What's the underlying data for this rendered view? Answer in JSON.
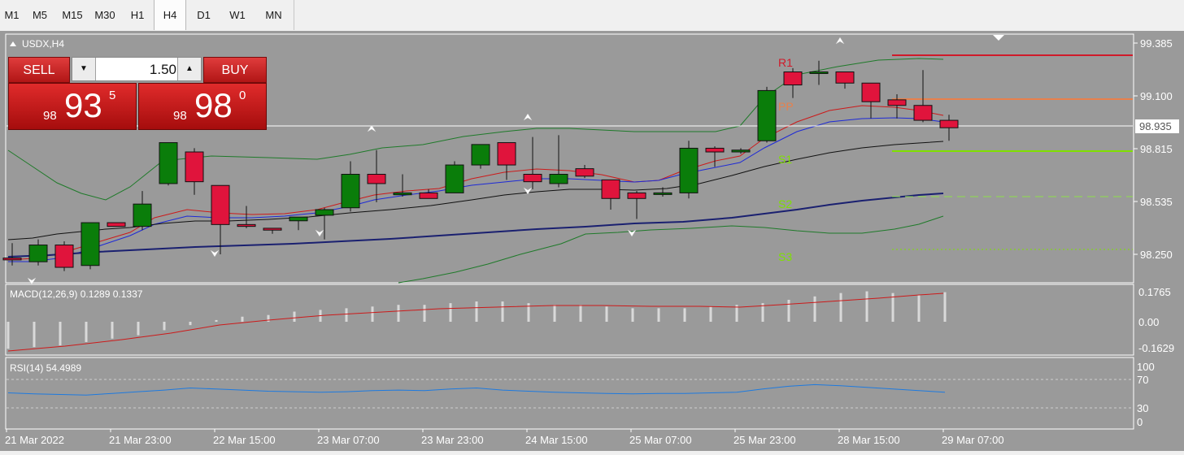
{
  "timeframes": [
    "M1",
    "M5",
    "M15",
    "M30",
    "H1",
    "H4",
    "D1",
    "W1",
    "MN"
  ],
  "active_timeframe": "H4",
  "chart": {
    "symbol_title": "USDX,H4",
    "price_axis": [
      "99.385",
      "99.100",
      "98.815",
      "98.535",
      "98.250"
    ],
    "current_price": "98.935",
    "pivot_labels": {
      "r1": "R1",
      "pp": "PP",
      "s1": "S1",
      "s2": "S2",
      "s3": "S3"
    },
    "date_labels": [
      "21 Mar 2022",
      "21 Mar 23:00",
      "22 Mar 15:00",
      "23 Mar 07:00",
      "23 Mar 23:00",
      "24 Mar 15:00",
      "25 Mar 07:00",
      "25 Mar 23:00",
      "28 Mar 15:00",
      "29 Mar 07:00"
    ]
  },
  "macd": {
    "label": "MACD(12,26,9) 0.1289 0.1337",
    "axis": [
      "0.1765",
      "0.00",
      "-0.1629"
    ]
  },
  "rsi": {
    "label": "RSI(14) 54.4989",
    "axis": [
      "100",
      "70",
      "30",
      "0"
    ]
  },
  "trade": {
    "sell_label": "SELL",
    "buy_label": "BUY",
    "volume": "1.50",
    "sell_price": {
      "small": "98",
      "big": "93",
      "sup": "5"
    },
    "buy_price": {
      "small": "98",
      "big": "98",
      "sup": "0"
    }
  },
  "colors": {
    "bull": "#0a7d0a",
    "bear": "#e0143c",
    "background": "#9a9a9a",
    "sell_button": "#c81e1e"
  },
  "chart_data": {
    "type": "candlestick",
    "candles": [
      {
        "o": 98.23,
        "h": 98.31,
        "l": 98.19,
        "c": 98.22
      },
      {
        "o": 98.21,
        "h": 98.33,
        "l": 98.19,
        "c": 98.3
      },
      {
        "o": 98.3,
        "h": 98.32,
        "l": 98.16,
        "c": 98.18
      },
      {
        "o": 98.19,
        "h": 98.42,
        "l": 98.17,
        "c": 98.42
      },
      {
        "o": 98.42,
        "h": 98.42,
        "l": 98.4,
        "c": 98.4
      },
      {
        "o": 98.4,
        "h": 98.59,
        "l": 98.38,
        "c": 98.52
      },
      {
        "o": 98.63,
        "h": 98.82,
        "l": 98.62,
        "c": 98.85
      },
      {
        "o": 98.8,
        "h": 98.82,
        "l": 98.57,
        "c": 98.64
      },
      {
        "o": 98.62,
        "h": 98.62,
        "l": 98.25,
        "c": 98.41
      },
      {
        "o": 98.41,
        "h": 98.51,
        "l": 98.39,
        "c": 98.4
      },
      {
        "o": 98.39,
        "h": 98.39,
        "l": 98.36,
        "c": 98.38
      },
      {
        "o": 98.43,
        "h": 98.45,
        "l": 98.38,
        "c": 98.45
      },
      {
        "o": 98.46,
        "h": 98.5,
        "l": 98.33,
        "c": 98.49
      },
      {
        "o": 98.5,
        "h": 98.75,
        "l": 98.48,
        "c": 98.68
      },
      {
        "o": 98.68,
        "h": 98.81,
        "l": 98.53,
        "c": 98.63
      },
      {
        "o": 98.57,
        "h": 98.68,
        "l": 98.56,
        "c": 98.58
      },
      {
        "o": 98.58,
        "h": 98.6,
        "l": 98.55,
        "c": 98.55
      },
      {
        "o": 98.58,
        "h": 98.75,
        "l": 98.58,
        "c": 98.73
      },
      {
        "o": 98.73,
        "h": 98.84,
        "l": 98.71,
        "c": 98.84
      },
      {
        "o": 98.85,
        "h": 98.85,
        "l": 98.65,
        "c": 98.73
      },
      {
        "o": 98.68,
        "h": 98.88,
        "l": 98.6,
        "c": 98.64
      },
      {
        "o": 98.63,
        "h": 98.89,
        "l": 98.61,
        "c": 98.68
      },
      {
        "o": 98.71,
        "h": 98.73,
        "l": 98.66,
        "c": 98.67
      },
      {
        "o": 98.65,
        "h": 98.65,
        "l": 98.49,
        "c": 98.55
      },
      {
        "o": 98.58,
        "h": 98.59,
        "l": 98.44,
        "c": 98.55
      },
      {
        "o": 98.58,
        "h": 98.61,
        "l": 98.56,
        "c": 98.58
      },
      {
        "o": 98.58,
        "h": 98.86,
        "l": 98.55,
        "c": 98.82
      },
      {
        "o": 98.82,
        "h": 98.83,
        "l": 98.72,
        "c": 98.8
      },
      {
        "o": 98.8,
        "h": 98.82,
        "l": 98.79,
        "c": 98.81
      },
      {
        "o": 98.86,
        "h": 99.15,
        "l": 98.85,
        "c": 99.13
      },
      {
        "o": 99.23,
        "h": 99.25,
        "l": 99.09,
        "c": 99.16
      },
      {
        "o": 99.23,
        "h": 99.29,
        "l": 99.16,
        "c": 99.23
      },
      {
        "o": 99.23,
        "h": 99.23,
        "l": 99.14,
        "c": 99.17
      },
      {
        "o": 99.17,
        "h": 99.17,
        "l": 98.98,
        "c": 99.07
      },
      {
        "o": 99.08,
        "h": 99.11,
        "l": 98.98,
        "c": 99.05
      },
      {
        "o": 99.05,
        "h": 99.24,
        "l": 98.96,
        "c": 98.97
      },
      {
        "o": 98.97,
        "h": 99.0,
        "l": 98.86,
        "c": 98.93
      }
    ],
    "price_range": [
      98.18,
      99.385
    ],
    "pivot_levels": {
      "r1": 99.3,
      "pp": 99.1,
      "s1": 98.81,
      "s2": 98.54,
      "s3": 98.25
    },
    "macd_histogram": [
      -0.16,
      -0.15,
      -0.14,
      -0.12,
      -0.1,
      -0.08,
      -0.05,
      -0.02,
      0.01,
      0.03,
      0.04,
      0.06,
      0.07,
      0.08,
      0.09,
      0.1,
      0.1,
      0.11,
      0.12,
      0.12,
      0.11,
      0.1,
      0.1,
      0.09,
      0.08,
      0.08,
      0.08,
      0.09,
      0.1,
      0.11,
      0.13,
      0.15,
      0.17,
      0.18,
      0.17,
      0.16,
      0.175
    ],
    "macd_axis_range": [
      -0.1629,
      0.1765
    ],
    "rsi": [
      53,
      51,
      50,
      49,
      52,
      55,
      58,
      62,
      60,
      58,
      56,
      55,
      54,
      55,
      57,
      58,
      57,
      60,
      62,
      58,
      56,
      54,
      53,
      52,
      51,
      52,
      52,
      53,
      54,
      60,
      65,
      68,
      66,
      63,
      60,
      57,
      54
    ],
    "rsi_levels": [
      70,
      30
    ]
  }
}
